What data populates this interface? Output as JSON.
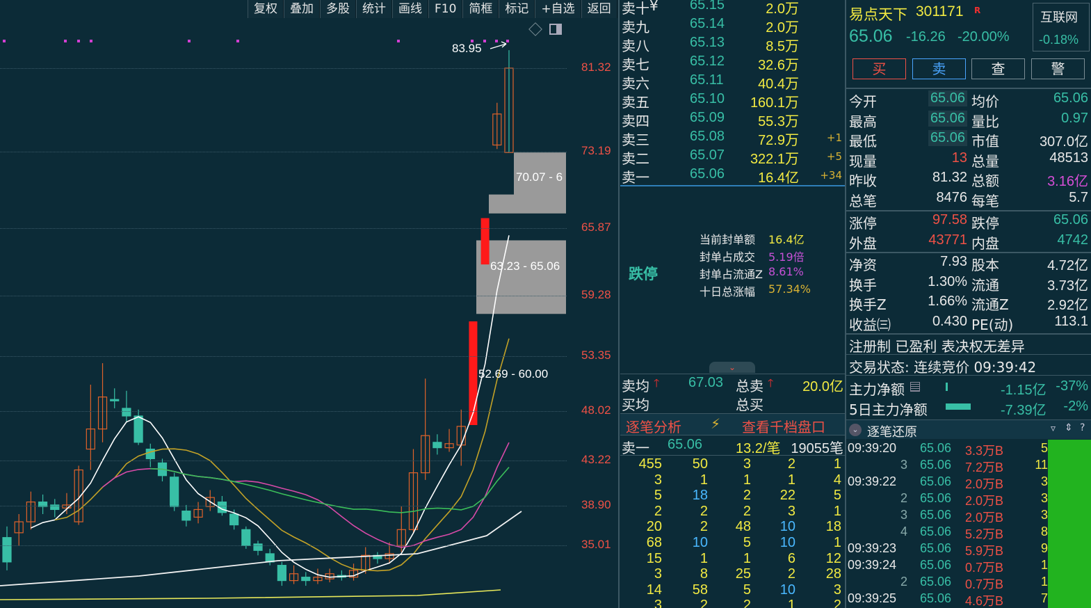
{
  "toolbar": [
    "复权",
    "叠加",
    "多股",
    "统计",
    "画线",
    "F10",
    "简框",
    "标记",
    "+自选",
    "返回"
  ],
  "price_axis": [
    "81.32",
    "73.19",
    "65.87",
    "59.28",
    "53.35",
    "48.02",
    "43.22",
    "38.90",
    "35.01"
  ],
  "annotations": {
    "peak": "83.95",
    "gap1": "70.07 - 6",
    "gap2": "63.23 - 65.06",
    "gap3": "52.69 - 60.00"
  },
  "chart_data": {
    "type": "candlestick",
    "note_axis": "log-like price axis labels 35.01–81.32",
    "candles": [
      {
        "o": 35.5,
        "c": 34.0,
        "h": 36.2,
        "l": 33.5
      },
      {
        "o": 35.8,
        "c": 36.5,
        "h": 37.0,
        "l": 35.0
      },
      {
        "o": 36.5,
        "c": 37.8,
        "h": 38.5,
        "l": 36.0
      },
      {
        "o": 37.8,
        "c": 37.5,
        "h": 38.3,
        "l": 37.0
      },
      {
        "o": 37.6,
        "c": 37.3,
        "h": 38.0,
        "l": 36.8
      },
      {
        "o": 37.4,
        "c": 37.6,
        "h": 38.4,
        "l": 37.0
      },
      {
        "o": 36.5,
        "c": 40.0,
        "h": 40.3,
        "l": 36.3
      },
      {
        "o": 41.5,
        "c": 43.0,
        "h": 46.5,
        "l": 40.0
      },
      {
        "o": 43.0,
        "c": 45.5,
        "h": 48.3,
        "l": 42.0
      },
      {
        "o": 45.3,
        "c": 45.2,
        "h": 46.2,
        "l": 44.6
      },
      {
        "o": 44.6,
        "c": 44.0,
        "h": 46.0,
        "l": 43.5
      },
      {
        "o": 44.0,
        "c": 42.0,
        "h": 44.5,
        "l": 41.8
      },
      {
        "o": 41.5,
        "c": 40.8,
        "h": 41.9,
        "l": 40.2
      },
      {
        "o": 40.5,
        "c": 39.6,
        "h": 40.8,
        "l": 39.2
      },
      {
        "o": 39.5,
        "c": 37.5,
        "h": 39.8,
        "l": 37.2
      },
      {
        "o": 37.2,
        "c": 36.6,
        "h": 37.6,
        "l": 36.2
      },
      {
        "o": 36.8,
        "c": 37.3,
        "h": 37.8,
        "l": 36.4
      },
      {
        "o": 37.5,
        "c": 38.1,
        "h": 38.6,
        "l": 37.2
      },
      {
        "o": 37.8,
        "c": 37.1,
        "h": 38.2,
        "l": 36.9
      },
      {
        "o": 37.0,
        "c": 36.3,
        "h": 37.3,
        "l": 36.0
      },
      {
        "o": 36.0,
        "c": 35.0,
        "h": 36.2,
        "l": 34.8
      },
      {
        "o": 35.1,
        "c": 34.7,
        "h": 35.3,
        "l": 34.4
      },
      {
        "o": 34.5,
        "c": 34.0,
        "h": 34.8,
        "l": 33.8
      },
      {
        "o": 33.8,
        "c": 32.9,
        "h": 34.0,
        "l": 32.6
      },
      {
        "o": 32.9,
        "c": 33.3,
        "h": 33.8,
        "l": 32.7
      },
      {
        "o": 33.1,
        "c": 32.9,
        "h": 33.4,
        "l": 32.6
      },
      {
        "o": 32.9,
        "c": 33.1,
        "h": 33.6,
        "l": 32.7
      },
      {
        "o": 33.0,
        "c": 33.3,
        "h": 33.6,
        "l": 32.8
      },
      {
        "o": 33.2,
        "c": 33.1,
        "h": 33.5,
        "l": 32.9
      },
      {
        "o": 33.1,
        "c": 33.5,
        "h": 33.9,
        "l": 32.9
      },
      {
        "o": 33.5,
        "c": 34.4,
        "h": 34.9,
        "l": 33.3
      },
      {
        "o": 34.4,
        "c": 34.2,
        "h": 34.6,
        "l": 33.9
      },
      {
        "o": 34.2,
        "c": 34.5,
        "h": 35.2,
        "l": 33.9
      },
      {
        "o": 35.0,
        "c": 36.0,
        "h": 37.5,
        "l": 34.6
      },
      {
        "o": 36.0,
        "c": 39.8,
        "h": 41.5,
        "l": 35.8
      },
      {
        "o": 39.8,
        "c": 42.5,
        "h": 47.0,
        "l": 39.3
      },
      {
        "o": 42.0,
        "c": 41.6,
        "h": 42.6,
        "l": 41.1
      },
      {
        "o": 41.6,
        "c": 41.9,
        "h": 43.0,
        "l": 41.3
      },
      {
        "o": 41.8,
        "c": 43.2,
        "h": 44.5,
        "l": 40.3
      },
      {
        "o": 43.3,
        "c": 52.0,
        "h": 52.0,
        "l": 43.3
      },
      {
        "o": 57.5,
        "c": 62.4,
        "h": 62.4,
        "l": 57.5
      },
      {
        "o": 71.0,
        "c": 75.0,
        "h": 76.5,
        "l": 70.5
      },
      {
        "o": 81.32,
        "c": 70.07,
        "h": 83.95,
        "l": 70.07
      }
    ],
    "gaps": [
      [
        63.23,
        65.06
      ],
      [
        52.69,
        60.0
      ]
    ]
  },
  "book": {
    "asks": [
      {
        "name": "卖十",
        "mark": "¥",
        "price": "65.15",
        "qty": "2.0万",
        "chg": ""
      },
      {
        "name": "卖九",
        "mark": "",
        "price": "65.14",
        "qty": "2.0万",
        "chg": ""
      },
      {
        "name": "卖八",
        "mark": "",
        "price": "65.13",
        "qty": "8.5万",
        "chg": ""
      },
      {
        "name": "卖七",
        "mark": "",
        "price": "65.12",
        "qty": "32.6万",
        "chg": ""
      },
      {
        "name": "卖六",
        "mark": "",
        "price": "65.11",
        "qty": "40.4万",
        "chg": ""
      },
      {
        "name": "卖五",
        "mark": "",
        "price": "65.10",
        "qty": "160.1万",
        "chg": ""
      },
      {
        "name": "卖四",
        "mark": "",
        "price": "65.09",
        "qty": "55.3万",
        "chg": ""
      },
      {
        "name": "卖三",
        "mark": "",
        "price": "65.08",
        "qty": "72.9万",
        "chg": "+1"
      },
      {
        "name": "卖二",
        "mark": "",
        "price": "65.07",
        "qty": "322.1万",
        "chg": "+5"
      },
      {
        "name": "卖一",
        "mark": "",
        "price": "65.06",
        "qty": "16.4亿",
        "chg": "+34"
      }
    ],
    "status": "跌停",
    "seal": [
      {
        "label": "当前封单额",
        "value": "16.4亿"
      },
      {
        "label": "封单占成交",
        "value": "5.19倍"
      },
      {
        "label": "封单占流通Z",
        "value": "8.61%"
      },
      {
        "label": "十日总涨幅",
        "value": "57.34%"
      }
    ],
    "avg_sell_label": "卖均",
    "avg_sell": "67.03",
    "total_sell_label": "总卖",
    "total_sell": "20.0亿",
    "avg_buy_label": "买均",
    "total_buy_label": "总买",
    "tab_analysis": "逐笔分析",
    "tab_depth": "查看千档盘口",
    "sell1_label": "卖一",
    "sell1_price": "65.06",
    "sell1_per": "13.2/笔",
    "sell1_count": "19055笔",
    "ticks": [
      [
        "455",
        "50",
        "3",
        "2",
        "1"
      ],
      [
        "3",
        "1",
        "1",
        "1",
        "4"
      ],
      [
        "5",
        "18",
        "2",
        "22",
        "5"
      ],
      [
        "2",
        "2",
        "2",
        "3",
        "1"
      ],
      [
        "20",
        "2",
        "48",
        "10",
        "18"
      ],
      [
        "68",
        "10",
        "5",
        "10",
        "1"
      ],
      [
        "15",
        "1",
        "1",
        "6",
        "12"
      ],
      [
        "3",
        "8",
        "25",
        "2",
        "28"
      ],
      [
        "14",
        "58",
        "5",
        "10",
        "3"
      ],
      [
        "3",
        "2",
        "2",
        "1",
        "2"
      ]
    ]
  },
  "info": {
    "name": "易点天下",
    "code": "301171",
    "tag": "R",
    "sector": "互联网",
    "sector_chg": "-0.18%",
    "price": "65.06",
    "change": "-16.26",
    "pct": "-20.00%",
    "buttons": [
      "买",
      "卖",
      "查",
      "警"
    ],
    "rows1": [
      [
        "今开",
        "65.06",
        "均价",
        "65.06"
      ],
      [
        "最高",
        "65.06",
        "量比",
        "0.97"
      ],
      [
        "最低",
        "65.06",
        "市值",
        "307.0亿"
      ],
      [
        "现量",
        "13",
        "总量",
        "48513"
      ],
      [
        "昨收",
        "81.32",
        "总额",
        "3.16亿"
      ],
      [
        "总笔",
        "8476",
        "每笔",
        "5.7"
      ]
    ],
    "rows2": [
      [
        "涨停",
        "97.58",
        "跌停",
        "65.06"
      ],
      [
        "外盘",
        "43771",
        "内盘",
        "4742"
      ]
    ],
    "rows3": [
      [
        "净资",
        "7.93",
        "股本",
        "4.72亿"
      ],
      [
        "换手",
        "1.30%",
        "流通",
        "3.73亿"
      ],
      [
        "换手Z",
        "1.66%",
        "流通Z",
        "2.92亿"
      ],
      [
        "收益㈢",
        "0.430",
        "PE(动)",
        "113.1"
      ]
    ],
    "reg": "注册制 已盈利 表决权无差异",
    "trade_state": "交易状态: 连续竞价 09:39:42",
    "main_net_label": "主力净额",
    "main_net": "-1.15亿",
    "main_net_pct": "-37%",
    "main5_label": "5日主力净额",
    "main5": "-7.39亿",
    "main5_pct": "-2%",
    "trade_title": "逐笔还原",
    "trades": [
      [
        "09:39:20",
        "",
        "65.06",
        "3.3万B",
        "5"
      ],
      [
        "",
        "3",
        "65.06",
        "7.2万B",
        "11"
      ],
      [
        "09:39:22",
        "",
        "65.06",
        "2.0万B",
        "3"
      ],
      [
        "",
        "2",
        "65.06",
        "2.0万B",
        "3"
      ],
      [
        "",
        "3",
        "65.06",
        "2.0万B",
        "3"
      ],
      [
        "",
        "4",
        "65.06",
        "5.2万B",
        "8"
      ],
      [
        "09:39:23",
        "",
        "65.06",
        "5.9万B",
        "9"
      ],
      [
        "09:39:24",
        "",
        "65.06",
        "0.7万B",
        "1"
      ],
      [
        "",
        "2",
        "65.06",
        "0.7万B",
        "1"
      ],
      [
        "09:39:25",
        "",
        "65.06",
        "4.6万B",
        "7"
      ]
    ]
  }
}
